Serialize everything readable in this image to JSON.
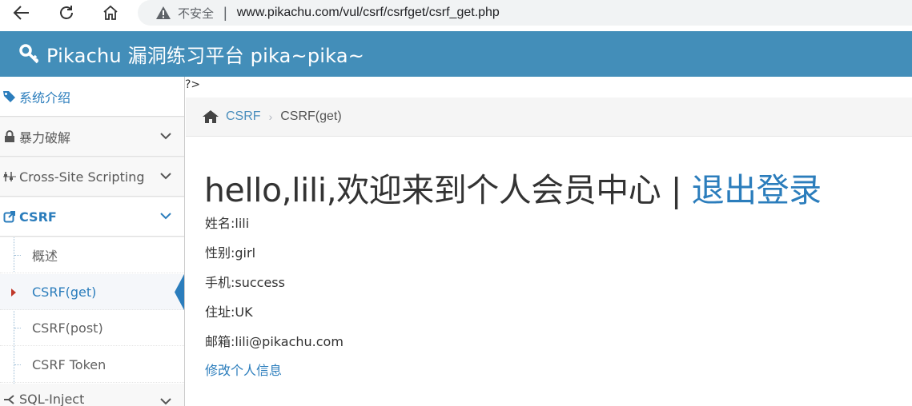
{
  "browser": {
    "insecure_label": "不安全",
    "separator": "|",
    "url": "www.pikachu.com/vul/csrf/csrfget/csrf_get.php"
  },
  "header": {
    "title": "Pikachu 漏洞练习平台 pika~pika~"
  },
  "sidebar": {
    "items": [
      {
        "label": "系统介绍",
        "icon": "tag-icon"
      },
      {
        "label": "暴力破解",
        "icon": "lock-icon"
      },
      {
        "label": "Cross-Site Scripting",
        "icon": "sliders-icon"
      },
      {
        "label": "CSRF",
        "icon": "external-link-icon"
      },
      {
        "label": "SQL-Inject",
        "icon": "fork-icon"
      }
    ],
    "csrf_subitems": [
      {
        "label": "概述"
      },
      {
        "label": "CSRF(get)"
      },
      {
        "label": "CSRF(post)"
      },
      {
        "label": "CSRF Token"
      }
    ]
  },
  "content": {
    "stray_text": "?>",
    "breadcrumb": {
      "link": "CSRF",
      "current": "CSRF(get)"
    },
    "title_greeting": "hello,lili,欢迎来到个人会员中心 | ",
    "title_logout": "退出登录",
    "info": [
      "姓名:lili",
      "性别:girl",
      "手机:success",
      "住址:UK",
      "邮箱:lili@pikachu.com"
    ],
    "edit_link": "修改个人信息"
  },
  "colors": {
    "header_bg": "#438eb9",
    "link": "#2b7dbc"
  }
}
